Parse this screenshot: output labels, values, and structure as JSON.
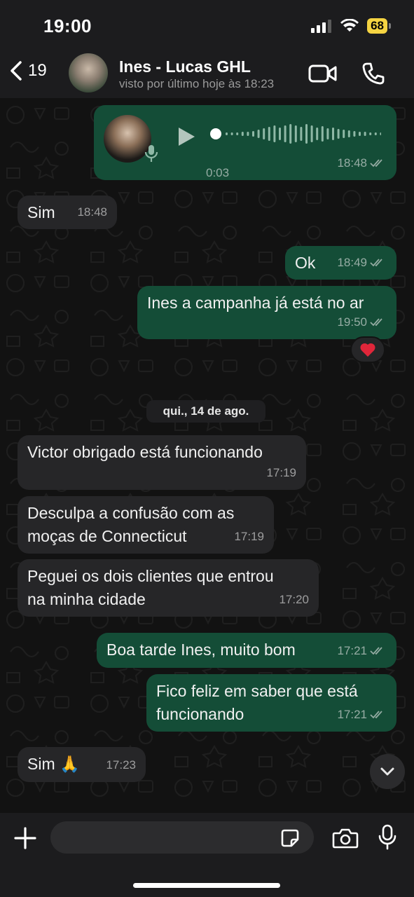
{
  "status_bar": {
    "time": "19:00",
    "battery": "68"
  },
  "header": {
    "back_count": "19",
    "contact_name": "Ines - Lucas GHL",
    "last_seen": "visto por último hoje às 18:23"
  },
  "audio_message": {
    "duration": "0:03",
    "time": "18:48",
    "direction": "outgoing",
    "read": true
  },
  "messages": [
    {
      "text": "Sim",
      "time": "18:48",
      "direction": "incoming"
    },
    {
      "text": "Ok",
      "time": "18:49",
      "direction": "outgoing"
    },
    {
      "text": "Ines a campanha já está no ar",
      "time": "19:50",
      "direction": "outgoing"
    },
    {
      "text": "Victor obrigado está funcionando",
      "time": "17:19",
      "direction": "incoming"
    },
    {
      "text_line1": "Desculpa a confusão com as",
      "text_line2": "moças de Connecticut",
      "time": "17:19",
      "direction": "incoming"
    },
    {
      "text_line1": "Peguei os dois clientes que entrou",
      "text_line2": "na minha cidade",
      "time": "17:20",
      "direction": "incoming"
    },
    {
      "text": "Boa tarde Ines, muito bom",
      "time": "17:21",
      "direction": "outgoing"
    },
    {
      "text_line1": "Fico feliz em saber que está",
      "text_line2": "funcionando",
      "time": "17:21",
      "direction": "outgoing"
    },
    {
      "text": "Sim 🙏",
      "time": "17:23",
      "direction": "incoming"
    }
  ],
  "reaction": "❤️",
  "date_separator": "qui., 14 de ago.",
  "input": {
    "placeholder": ""
  },
  "colors": {
    "outgoing_bubble": "#144d37",
    "incoming_bubble": "#262628",
    "background": "#121212"
  },
  "icons": [
    "chevron-left-icon",
    "video-call-icon",
    "phone-icon",
    "play-icon",
    "microphone-icon",
    "double-check-icon",
    "chevron-down-icon",
    "plus-icon",
    "sticker-icon",
    "camera-icon"
  ]
}
